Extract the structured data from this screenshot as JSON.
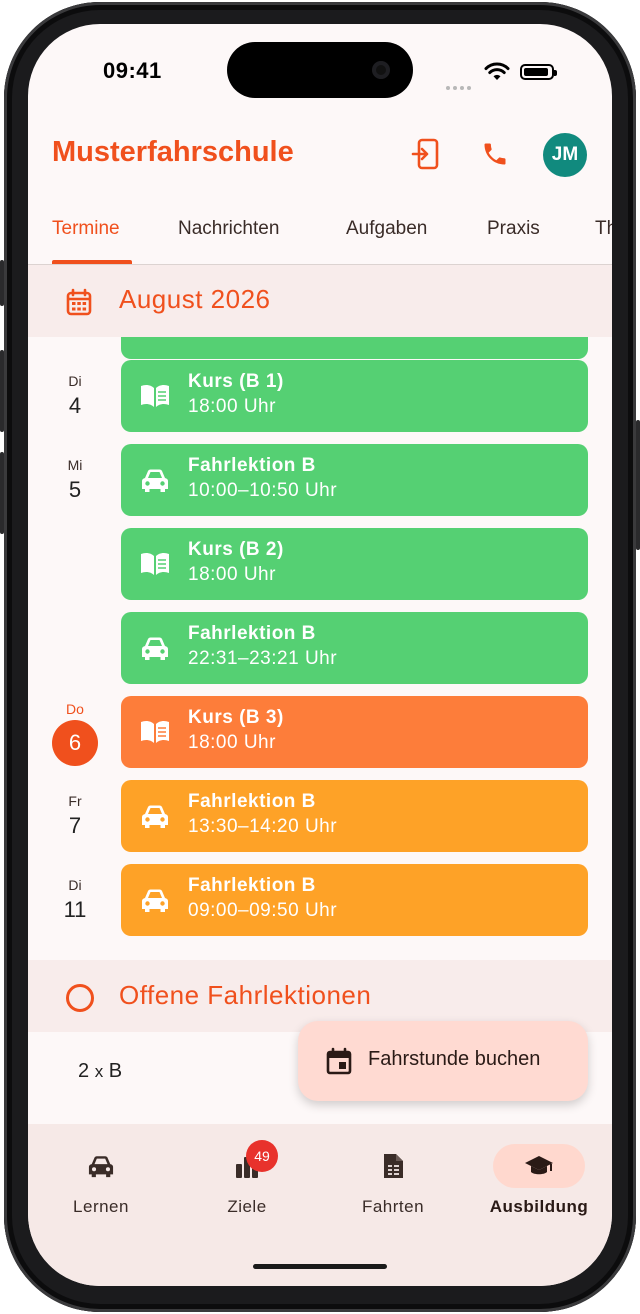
{
  "status_bar": {
    "time": "09:41"
  },
  "header": {
    "app_title": "Musterfahrschule",
    "avatar_initials": "JM",
    "accent_color": "#f0501d"
  },
  "tabs": [
    {
      "label": "Termine",
      "active": true
    },
    {
      "label": "Nachrichten"
    },
    {
      "label": "Aufgaben"
    },
    {
      "label": "Praxis"
    },
    {
      "label": "Th"
    }
  ],
  "month": {
    "title": "August 2026",
    "icon": "calendar-icon"
  },
  "days": {
    "d1": {
      "dow": "Di",
      "date": "4"
    },
    "d2": {
      "dow": "Mi",
      "date": "5"
    },
    "d3": {
      "dow": "Do",
      "date": "6",
      "today": true
    },
    "d4": {
      "dow": "Fr",
      "date": "7"
    },
    "d5": {
      "dow": "Di",
      "date": "11"
    }
  },
  "appointments": [
    {
      "title": "Kurs (B 1)",
      "time": "18:00 Uhr",
      "icon": "book-icon",
      "color": "#55d073"
    },
    {
      "title": "Fahrlektion B",
      "time": "10:00–10:50 Uhr",
      "icon": "car-icon",
      "color": "#55d073"
    },
    {
      "title": "Kurs (B 2)",
      "time": "18:00 Uhr",
      "icon": "book-icon",
      "color": "#55d073"
    },
    {
      "title": "Fahrlektion B",
      "time": "22:31–23:21 Uhr",
      "icon": "car-icon",
      "color": "#55d073"
    },
    {
      "title": "Kurs (B 3)",
      "time": "18:00 Uhr",
      "icon": "book-icon",
      "color": "#fd7d3a"
    },
    {
      "title": "Fahrlektion B",
      "time": "13:30–14:20 Uhr",
      "icon": "car-icon",
      "color": "#fea227"
    },
    {
      "title": "Fahrlektion B",
      "time": "09:00–09:50 Uhr",
      "icon": "car-icon",
      "color": "#fea227"
    }
  ],
  "open_lessons": {
    "title": "Offene Fahrlektionen",
    "count": "2",
    "multiplier": "x",
    "category": "B"
  },
  "fab": {
    "label": "Fahrstunde buchen",
    "icon": "calendar-add-icon"
  },
  "bottom_nav": [
    {
      "label": "Lernen",
      "icon": "car-icon"
    },
    {
      "label": "Ziele",
      "icon": "bar-chart-icon",
      "badge": "49"
    },
    {
      "label": "Fahrten",
      "icon": "document-icon"
    },
    {
      "label": "Ausbildung",
      "icon": "graduation-cap-icon",
      "active": true
    }
  ]
}
